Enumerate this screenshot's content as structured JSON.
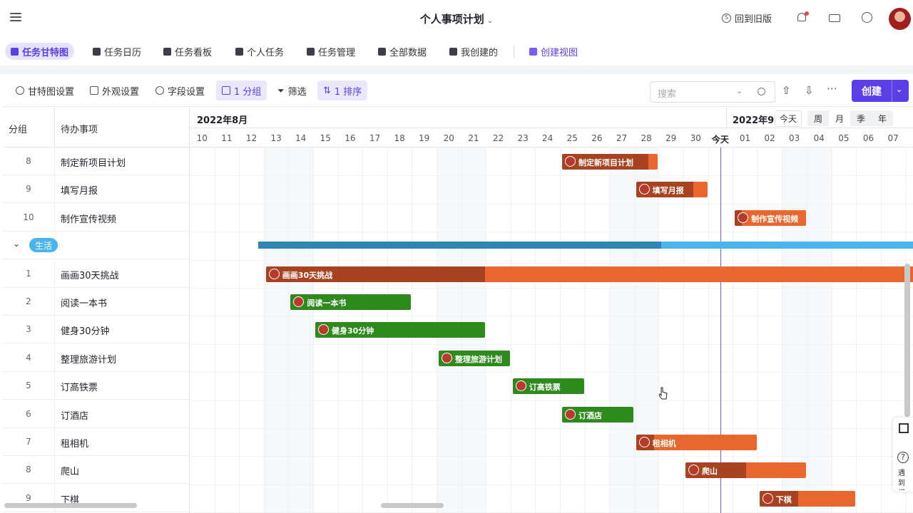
{
  "app": {
    "title": "个人事项计划",
    "back_old": "回到旧版"
  },
  "view_tabs": [
    {
      "label": "任务甘特图",
      "active": true
    },
    {
      "label": "任务日历"
    },
    {
      "label": "任务看板"
    },
    {
      "label": "个人任务"
    },
    {
      "label": "任务管理"
    },
    {
      "label": "全部数据"
    },
    {
      "label": "我创建的"
    },
    {
      "label": "创建视图",
      "create": true
    }
  ],
  "toolbar": {
    "gantt_settings": "甘特图设置",
    "appearance": "外观设置",
    "fields": "字段设置",
    "group": "1 分组",
    "filter": "筛选",
    "sort": "1 排序",
    "search_placeholder": "搜索",
    "create": "创建"
  },
  "left": {
    "col_group": "分组",
    "col_task": "待办事项",
    "rows": [
      {
        "type": "task",
        "idx": "8",
        "name": "制定新项目计划"
      },
      {
        "type": "task",
        "idx": "9",
        "name": "填写月报"
      },
      {
        "type": "task",
        "idx": "10",
        "name": "制作宣传视频"
      },
      {
        "type": "group",
        "name": "生活"
      },
      {
        "type": "task",
        "idx": "1",
        "name": "画画30天挑战"
      },
      {
        "type": "task",
        "idx": "2",
        "name": "阅读一本书"
      },
      {
        "type": "task",
        "idx": "3",
        "name": "健身30分钟"
      },
      {
        "type": "task",
        "idx": "4",
        "name": "整理旅游计划"
      },
      {
        "type": "task",
        "idx": "5",
        "name": "订高铁票"
      },
      {
        "type": "task",
        "idx": "6",
        "name": "订酒店"
      },
      {
        "type": "task",
        "idx": "7",
        "name": "租相机"
      },
      {
        "type": "task",
        "idx": "8",
        "name": "爬山"
      },
      {
        "type": "task",
        "idx": "9",
        "name": "下棋"
      }
    ]
  },
  "timeline": {
    "month1": "2022年8月",
    "month2": "2022年9",
    "today_btn": "今天",
    "scales": [
      "周",
      "月",
      "季",
      "年"
    ],
    "selected_scale": "月",
    "days": [
      "10",
      "11",
      "12",
      "13",
      "14",
      "15",
      "16",
      "17",
      "18",
      "19",
      "20",
      "21",
      "22",
      "23",
      "24",
      "25",
      "26",
      "27",
      "28",
      "29",
      "30",
      "今天",
      "01",
      "02",
      "03",
      "04",
      "05",
      "06",
      "07"
    ],
    "today_label": "今天"
  },
  "colors": {
    "accent": "#5b3ee8",
    "orange": "#e8672e",
    "orange_done": "#a84322",
    "green": "#2f8a1e",
    "blue_group": "#2f86b6",
    "blue_group_rest": "#4ab5ec"
  },
  "bars": [
    {
      "row": 0,
      "label": "制定新项目计划",
      "start": 15,
      "end": 19,
      "progress": 0.9,
      "color": "orange"
    },
    {
      "row": 1,
      "label": "填写月报",
      "start": 18,
      "end": 21,
      "progress": 0.8,
      "color": "orange"
    },
    {
      "row": 2,
      "label": "制作宣传视频",
      "start": 22,
      "end": 25,
      "progress": 0.1,
      "color": "orange"
    },
    {
      "row": 4,
      "label": "画画30天挑战",
      "start": 3,
      "end": 30,
      "progress": 0.33,
      "color": "orange"
    },
    {
      "row": 5,
      "label": "阅读一本书",
      "start": 4,
      "end": 9,
      "progress": 1.0,
      "color": "green"
    },
    {
      "row": 6,
      "label": "健身30分钟",
      "start": 5,
      "end": 12,
      "progress": 1.0,
      "color": "green"
    },
    {
      "row": 7,
      "label": "整理旅游计划",
      "start": 10,
      "end": 13,
      "progress": 1.0,
      "color": "green"
    },
    {
      "row": 8,
      "label": "订高铁票",
      "start": 13,
      "end": 16,
      "progress": 1.0,
      "color": "green"
    },
    {
      "row": 9,
      "label": "订酒店",
      "start": 15,
      "end": 18,
      "progress": 1.0,
      "color": "green"
    },
    {
      "row": 10,
      "label": "租相机",
      "start": 18,
      "end": 23,
      "progress": 0.15,
      "color": "orange"
    },
    {
      "row": 11,
      "label": "爬山",
      "start": 20,
      "end": 25,
      "progress": 0.5,
      "color": "orange"
    },
    {
      "row": 12,
      "label": "下棋",
      "start": 23,
      "end": 27,
      "progress": 0.4,
      "color": "orange"
    }
  ],
  "group_bar": {
    "row": 3,
    "start": 3,
    "end": 30,
    "progress": 0.6
  },
  "help": {
    "label": "遇到问题"
  }
}
